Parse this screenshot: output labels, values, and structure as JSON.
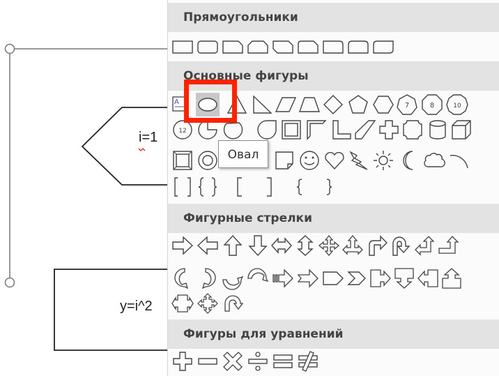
{
  "document": {
    "hex_label": "i=1",
    "rect_label": "y=i^2"
  },
  "gallery": {
    "categories": [
      {
        "title": "Прямоугольники",
        "shapes": [
          "rectangle-icon",
          "rounded-rectangle-icon",
          "snip-corner-rectangle-icon",
          "snip-two-corner-rectangle-icon",
          "snip-diagonal-rectangle-icon",
          "snip-round-rectangle-icon",
          "round-single-corner-rectangle-icon",
          "round-same-side-rectangle-icon",
          "round-diagonal-rectangle-icon"
        ]
      },
      {
        "title": "Основные фигуры",
        "rows": [
          [
            "text-box-icon",
            "oval-icon",
            "isosceles-triangle-icon",
            "right-triangle-icon",
            "parallelogram-icon",
            "trapezoid-icon",
            "diamond-icon",
            "pentagon-icon",
            "hexagon-icon",
            "heptagon-icon",
            "octagon-icon",
            "decagon-icon"
          ],
          [
            "dodecagon-icon",
            "pie-icon",
            "chord-icon",
            "teardrop-icon",
            "frame-icon",
            "half-frame-icon",
            "l-shape-icon",
            "diagonal-stripe-icon",
            "cross-icon",
            "plaque-icon",
            "can-icon",
            "cube-icon"
          ],
          [
            "bevel-icon",
            "donut-icon",
            "no-symbol-icon",
            "block-arc-icon",
            "folded-corner-icon",
            "smiley-face-icon",
            "heart-icon",
            "lightning-bolt-icon",
            "sun-icon",
            "moon-icon",
            "cloud-icon",
            "arc-icon"
          ],
          [
            "double-bracket-icon",
            "double-brace-icon",
            "left-bracket-icon",
            "right-bracket-icon",
            "left-brace-icon",
            "right-brace-icon"
          ]
        ],
        "octagon_number_labels": [
          "7",
          "8",
          "10",
          "12"
        ]
      },
      {
        "title": "Фигурные стрелки",
        "rows": [
          [
            "right-arrow-icon",
            "left-arrow-icon",
            "up-arrow-icon",
            "down-arrow-icon",
            "left-right-arrow-icon",
            "up-down-arrow-icon",
            "quad-arrow-icon",
            "left-right-up-arrow-icon",
            "bent-arrow-icon",
            "u-turn-arrow-icon",
            "left-up-arrow-icon",
            "bent-up-arrow-icon"
          ],
          [
            "curved-right-arrow-icon",
            "curved-left-arrow-icon",
            "curved-up-arrow-icon",
            "curved-down-arrow-icon",
            "striped-right-arrow-icon",
            "notched-right-arrow-icon",
            "pentagon-arrow-icon",
            "chevron-arrow-icon",
            "right-arrow-callout-icon",
            "down-arrow-callout-icon",
            "left-arrow-callout-icon",
            "up-arrow-callout-icon"
          ],
          [
            "left-right-arrow-callout-icon",
            "quad-arrow-callout-icon",
            "circular-arrow-icon"
          ]
        ]
      },
      {
        "title": "Фигуры для уравнений",
        "shapes": [
          "plus-icon",
          "minus-icon",
          "multiply-icon",
          "division-icon",
          "equal-icon",
          "not-equal-icon"
        ]
      }
    ],
    "tooltip": "Овал"
  }
}
